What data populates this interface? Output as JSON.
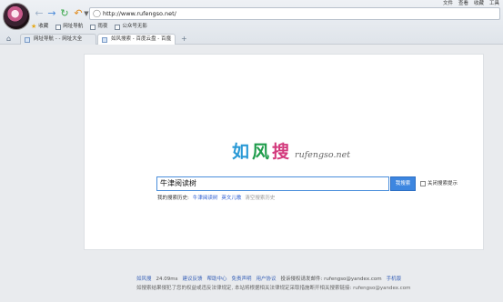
{
  "browser": {
    "menu": [
      "文件",
      "查看",
      "收藏",
      "工具"
    ],
    "url": "http://www.rufengso.net/",
    "bookmarks": [
      {
        "label": "收藏"
      },
      {
        "label": "网址导航"
      },
      {
        "label": "雨夜"
      },
      {
        "label": "公众号无影"
      }
    ],
    "tabs": [
      {
        "label": "网址导航 - - 网址大全"
      },
      {
        "label": "如风搜索 - 百度云盘 - 百度"
      }
    ],
    "new_tab": "+"
  },
  "page": {
    "logo": {
      "chars": [
        "如",
        "风",
        "搜"
      ],
      "sub": "rufengso.net",
      "colors": [
        "#2b9ad6",
        "#1e9c4b",
        "#d33a7d"
      ]
    },
    "search": {
      "value": "牛津阅读树",
      "button": "我搜索",
      "suggest_label": "关闭搜索提示"
    },
    "history": {
      "label": "我的搜索历史:",
      "items": [
        "牛津阅读树",
        "英文儿歌"
      ],
      "clear": "清空搜索历史"
    },
    "footer": {
      "items": [
        "如风搜",
        "24.09ms",
        "建议反馈",
        "帮助中心",
        "免责声明",
        "用户协议",
        "投诉侵权请发邮件: rufengso@yandex.com",
        "手机版"
      ],
      "notice": "如搜索结果侵犯了您的权益或违反法律规定, 本站将根据相关法律规定采取措施断开相关搜索链接: rufengso@yandex.com"
    }
  }
}
